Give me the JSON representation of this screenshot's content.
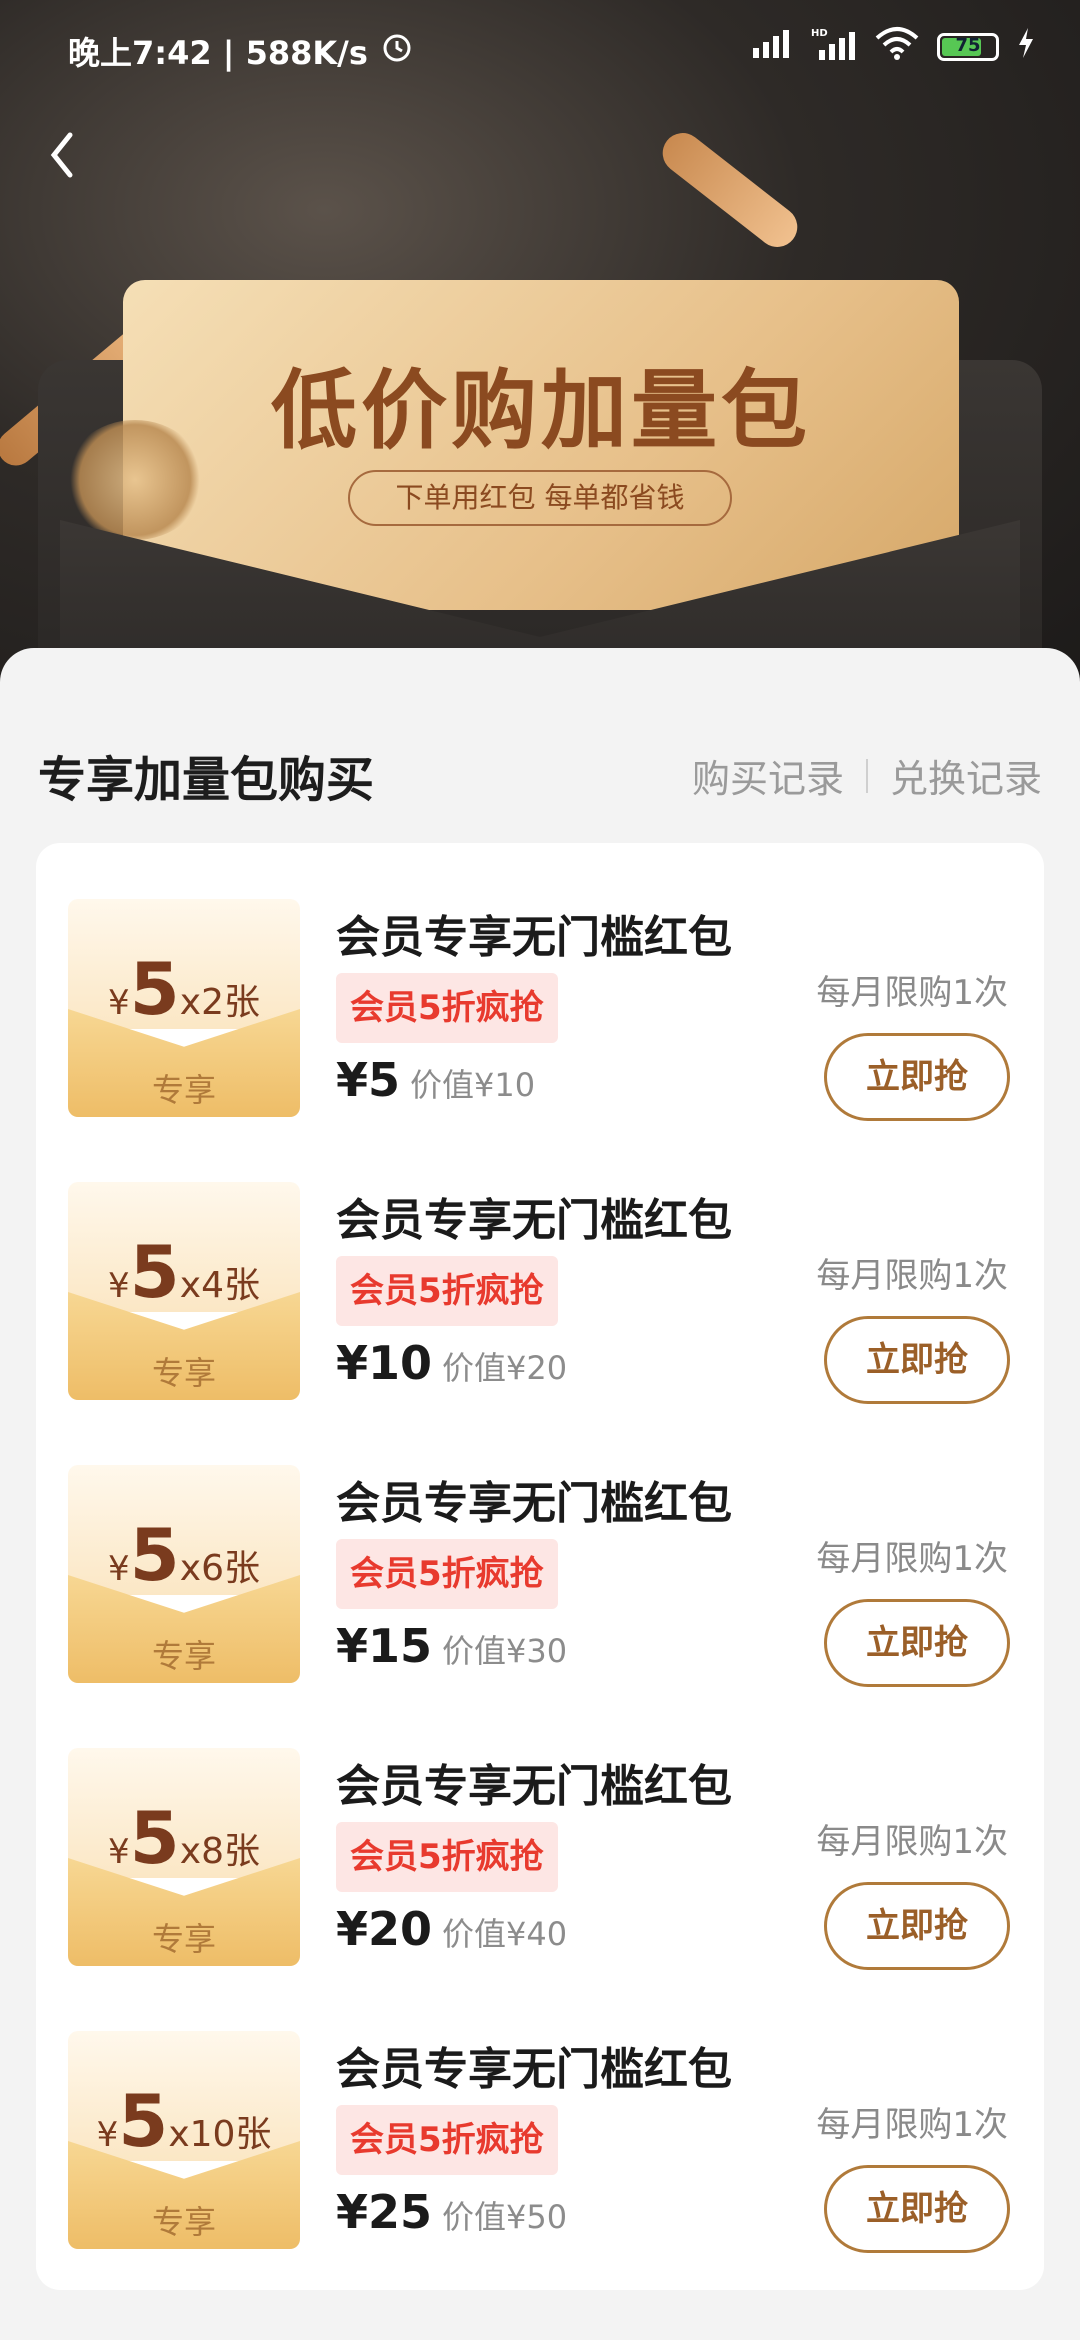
{
  "status_bar": {
    "time_speed": "晚上7:42 | 588K/s",
    "battery": "75"
  },
  "hero": {
    "title": "低价购加量包",
    "subtitle": "下单用红包 每单都省钱"
  },
  "section": {
    "title": "专享加量包购买",
    "purchase_record": "购买记录",
    "exchange_record": "兑换记录"
  },
  "items": [
    {
      "amount": "5",
      "qty": "x2张",
      "tag": "专享",
      "name": "会员专享无门槛红包",
      "badge": "会员5折疯抢",
      "price": "¥5",
      "value": "价值¥10",
      "limit": "每月限购1次",
      "button": "立即抢"
    },
    {
      "amount": "5",
      "qty": "x4张",
      "tag": "专享",
      "name": "会员专享无门槛红包",
      "badge": "会员5折疯抢",
      "price": "¥10",
      "value": "价值¥20",
      "limit": "每月限购1次",
      "button": "立即抢"
    },
    {
      "amount": "5",
      "qty": "x6张",
      "tag": "专享",
      "name": "会员专享无门槛红包",
      "badge": "会员5折疯抢",
      "price": "¥15",
      "value": "价值¥30",
      "limit": "每月限购1次",
      "button": "立即抢"
    },
    {
      "amount": "5",
      "qty": "x8张",
      "tag": "专享",
      "name": "会员专享无门槛红包",
      "badge": "会员5折疯抢",
      "price": "¥20",
      "value": "价值¥40",
      "limit": "每月限购1次",
      "button": "立即抢"
    },
    {
      "amount": "5",
      "qty": "x10张",
      "tag": "专享",
      "name": "会员专享无门槛红包",
      "badge": "会员5折疯抢",
      "price": "¥25",
      "value": "价值¥50",
      "limit": "每月限购1次",
      "button": "立即抢"
    }
  ],
  "currency_symbol": "¥",
  "colors": {
    "accent_brown": "#9b5f28",
    "badge_red": "#e83a2e",
    "badge_bg": "#fde6e4"
  }
}
